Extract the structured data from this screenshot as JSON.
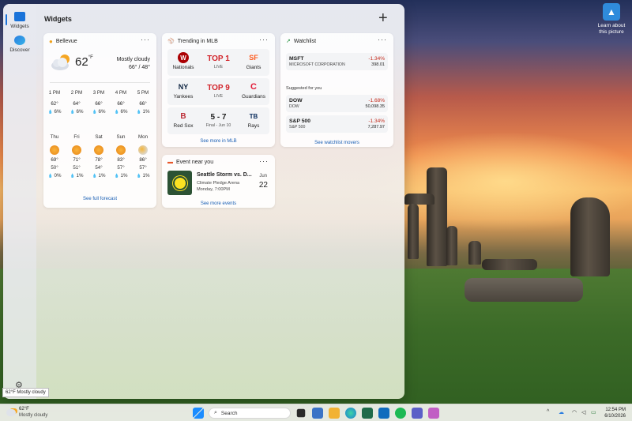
{
  "panel": {
    "title": "Widgets",
    "add_label": "+"
  },
  "rail": {
    "widgets_label": "Widgets",
    "discover_label": "Discover"
  },
  "weather": {
    "location": "Bellevue",
    "temp": "62",
    "unit": "°F",
    "condition": "Mostly cloudy",
    "hilo": "66° / 48°",
    "hourly": [
      {
        "time": "1 PM",
        "temp": "62°",
        "precip": "6%"
      },
      {
        "time": "2 PM",
        "temp": "64°",
        "precip": "6%"
      },
      {
        "time": "3 PM",
        "temp": "66°",
        "precip": "6%"
      },
      {
        "time": "4 PM",
        "temp": "66°",
        "precip": "6%"
      },
      {
        "time": "5 PM",
        "temp": "66°",
        "precip": "1%"
      }
    ],
    "daily": [
      {
        "day": "Thu",
        "hi": "69°",
        "lo": "50°",
        "precip": "0%"
      },
      {
        "day": "Fri",
        "hi": "71°",
        "lo": "51°",
        "precip": "1%"
      },
      {
        "day": "Sat",
        "hi": "78°",
        "lo": "54°",
        "precip": "1%"
      },
      {
        "day": "Sun",
        "hi": "83°",
        "lo": "57°",
        "precip": "1%"
      },
      {
        "day": "Mon",
        "hi": "86°",
        "lo": "57°",
        "precip": "1%"
      }
    ],
    "link": "See full forecast"
  },
  "mlb": {
    "title": "Trending in MLB",
    "games": [
      {
        "away": "Nationals",
        "home": "Giants",
        "status": "TOP 1",
        "sub": "LIVE",
        "away_logo": "W",
        "home_logo": "SF",
        "away_color": "#ab0003",
        "home_color": "#fd5a1e"
      },
      {
        "away": "Yankees",
        "home": "Guardians",
        "status": "TOP 9",
        "sub": "LIVE",
        "away_logo": "NY",
        "home_logo": "C",
        "away_color": "#0c2340",
        "home_color": "#e31937"
      },
      {
        "away": "Red Sox",
        "home": "Rays",
        "status": "5 - 7",
        "sub": "Final - Jun 10",
        "away_logo": "B",
        "home_logo": "TB",
        "away_color": "#bd3039",
        "home_color": "#092c5c"
      }
    ],
    "link": "See more in MLB"
  },
  "watchlist": {
    "title": "Watchlist",
    "items": [
      {
        "symbol": "MSFT",
        "name": "MICROSOFT CORPORATION",
        "change": "-1.34%",
        "price": "398.01"
      }
    ],
    "suggested_label": "Suggested for you",
    "suggested": [
      {
        "symbol": "DOW",
        "name": "DOW",
        "change": "-1.68%",
        "price": "50,098.35"
      },
      {
        "symbol": "S&P 500",
        "name": "S&P 500",
        "change": "-1.34%",
        "price": "7,287.97"
      }
    ],
    "link": "See watchlist movers"
  },
  "event": {
    "title": "Event near you",
    "name": "Seattle Storm vs. D...",
    "venue": "Climate Pledge Arena",
    "when": "Monday, 7:00PM",
    "month": "Jun",
    "day": "22",
    "link": "See more events"
  },
  "desktop": {
    "learn_label": "Learn about this picture"
  },
  "taskbar": {
    "weather_temp": "62°F",
    "weather_cond": "Mostly cloudy",
    "search_placeholder": "Search",
    "time": "12:54 PM",
    "date": "6/10/2026"
  },
  "tooltip": "62°F Mostly cloudy",
  "colors": {
    "accent": "#1a73d9",
    "negative": "#c42b1c",
    "live": "#d2232a"
  }
}
